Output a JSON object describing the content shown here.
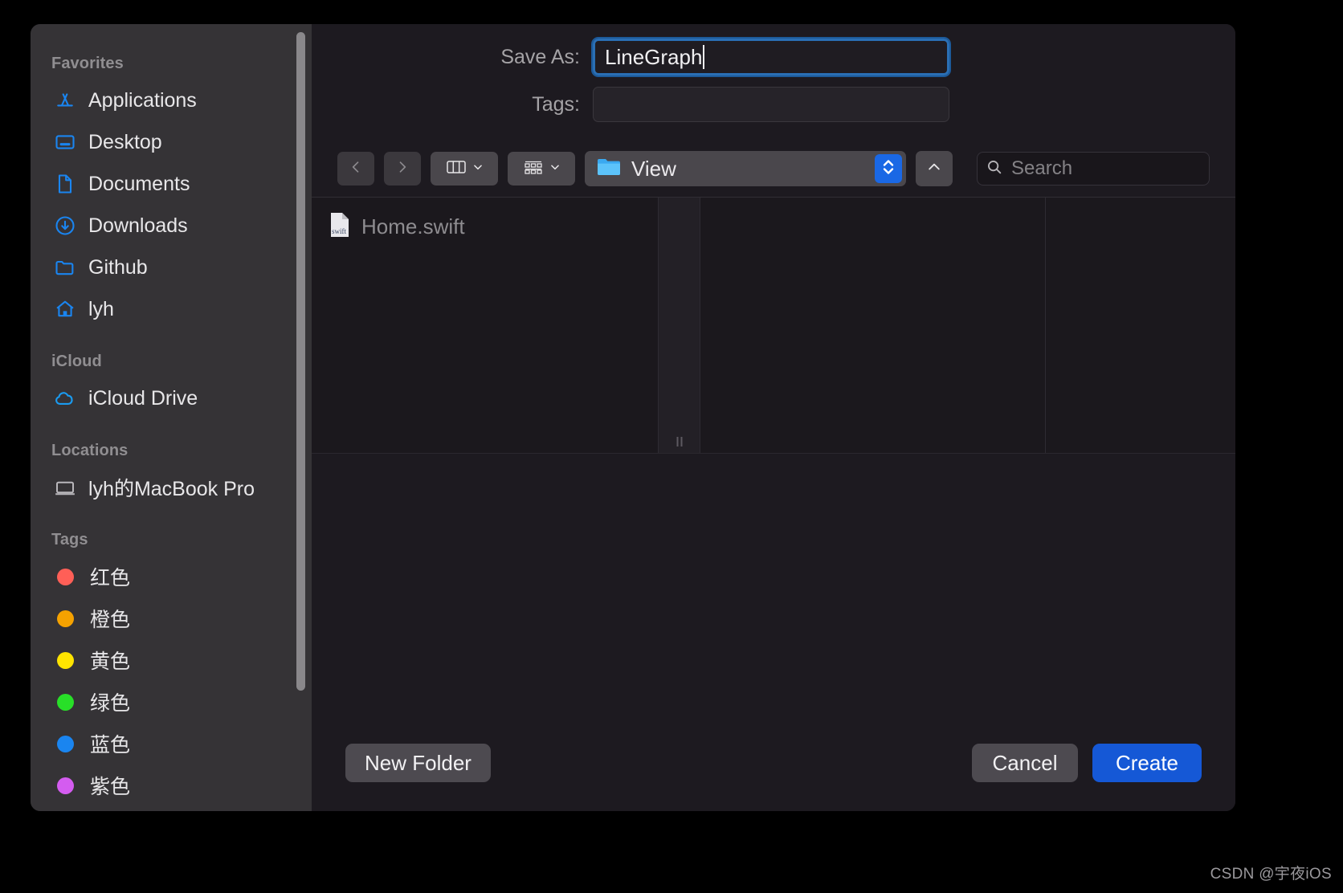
{
  "dialog": {
    "save_as_label": "Save As:",
    "save_as_value": "LineGraph",
    "tags_label": "Tags:",
    "tags_value": ""
  },
  "sidebar": {
    "sections": [
      {
        "title": "Favorites",
        "items": [
          {
            "label": "Applications",
            "icon": "applications-icon"
          },
          {
            "label": "Desktop",
            "icon": "desktop-icon"
          },
          {
            "label": "Documents",
            "icon": "document-icon"
          },
          {
            "label": "Downloads",
            "icon": "downloads-icon"
          },
          {
            "label": "Github",
            "icon": "folder-icon"
          },
          {
            "label": "lyh",
            "icon": "home-icon"
          }
        ]
      },
      {
        "title": "iCloud",
        "items": [
          {
            "label": "iCloud Drive",
            "icon": "cloud-icon"
          }
        ]
      },
      {
        "title": "Locations",
        "items": [
          {
            "label": "lyh的MacBook Pro",
            "icon": "laptop-icon"
          }
        ]
      },
      {
        "title": "Tags",
        "items": [
          {
            "label": "红色",
            "icon": "tag-dot",
            "color": "#ff5f57"
          },
          {
            "label": "橙色",
            "icon": "tag-dot",
            "color": "#f5a200"
          },
          {
            "label": "黄色",
            "icon": "tag-dot",
            "color": "#ffe400"
          },
          {
            "label": "绿色",
            "icon": "tag-dot",
            "color": "#28df28"
          },
          {
            "label": "蓝色",
            "icon": "tag-dot",
            "color": "#1a85f0"
          },
          {
            "label": "紫色",
            "icon": "tag-dot",
            "color": "#d45cf0"
          }
        ]
      }
    ]
  },
  "toolbar": {
    "back_icon": "chevron-left-icon",
    "forward_icon": "chevron-right-icon",
    "view_mode_icon": "column-view-icon",
    "group_icon": "group-by-icon",
    "path_label": "View",
    "path_folder_icon": "folder-icon",
    "stepper_icon": "up-down-chevron-icon",
    "up_icon": "chevron-up-icon",
    "search_icon": "search-icon",
    "search_placeholder": "Search",
    "search_value": ""
  },
  "browser": {
    "files": [
      {
        "name": "Home.swift",
        "icon": "swift-file-icon",
        "badge": "swift"
      }
    ]
  },
  "buttons": {
    "new_folder": "New Folder",
    "cancel": "Cancel",
    "create": "Create"
  },
  "watermark": "CSDN @宇夜iOS",
  "colors": {
    "accent": "#1558d6",
    "sidebar_bg": "#353336",
    "dialog_bg": "#1d1a20",
    "field_focus_border": "#2a6fb5",
    "icon_blue": "#1a85f0"
  }
}
